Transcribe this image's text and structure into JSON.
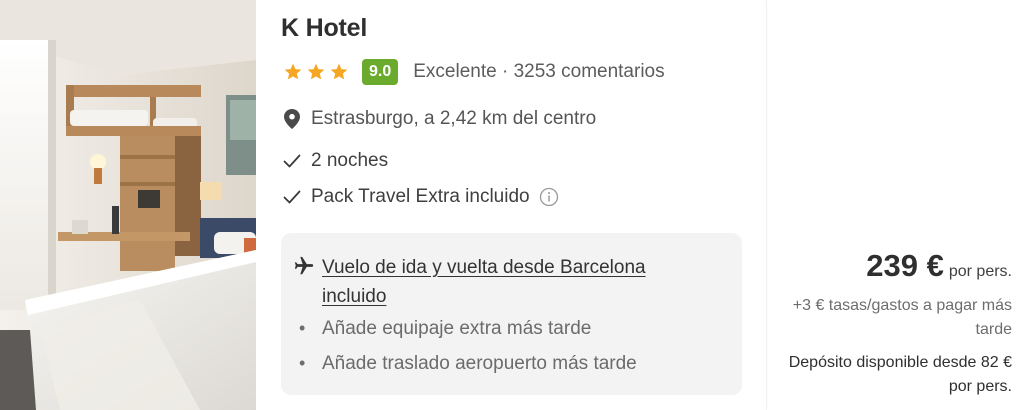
{
  "hotel": {
    "image_alt": "Habitación de hotel con cama, escritorio y estanterías de madera",
    "name": "K Hotel",
    "stars": 3,
    "star_color": "#f5a623",
    "score": "9.0",
    "score_color": "#6aab2e",
    "rating_label": "Excelente · 3253 comentarios",
    "location": "Estrasburgo, a 2,42 km del centro",
    "nights": "2 noches",
    "pack": "Pack Travel Extra incluido"
  },
  "flight": {
    "title": "Vuelo de ida y vuelta desde Barcelona incluido",
    "extras": [
      "Añade equipaje extra más tarde",
      "Añade traslado aeropuerto más tarde"
    ]
  },
  "price": {
    "amount": "239 €",
    "per": "por pers.",
    "taxes": "+3 € tasas/gastos a pagar más tarde",
    "deposit": "Depósito disponible desde 82 € por pers."
  },
  "icons": {
    "star": "star-icon",
    "location": "location-pin-icon",
    "check": "check-icon",
    "info": "info-icon",
    "plane": "plane-icon"
  }
}
